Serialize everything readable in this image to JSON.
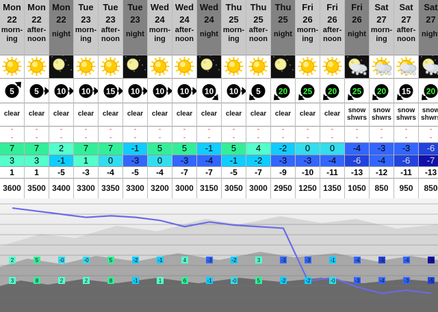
{
  "columns": [
    {
      "day": "Mon",
      "date": "22",
      "period": [
        "morn-",
        "ing"
      ],
      "night": false,
      "sym": "sun",
      "wind": "5",
      "windDir": "sw",
      "weather": [
        "clear"
      ],
      "rain": "-",
      "snow": "-",
      "max": "7",
      "min": "3",
      "chill": "1",
      "freezing": "3600"
    },
    {
      "day": "Mon",
      "date": "22",
      "period": [
        "after-",
        "noon"
      ],
      "night": false,
      "sym": "sun",
      "wind": "5",
      "windDir": "w",
      "weather": [
        "clear"
      ],
      "rain": "-",
      "snow": "-",
      "max": "7",
      "min": "3",
      "chill": "1",
      "freezing": "3500"
    },
    {
      "day": "Mon",
      "date": "22",
      "period": [
        "night"
      ],
      "night": true,
      "sym": "moon",
      "wind": "10",
      "windDir": "w",
      "weather": [
        "clear"
      ],
      "rain": "-",
      "snow": "-",
      "max": "2",
      "min": "-1",
      "chill": "-5",
      "freezing": "3400"
    },
    {
      "day": "Tue",
      "date": "23",
      "period": [
        "morn-",
        "ing"
      ],
      "night": false,
      "sym": "sun",
      "wind": "10",
      "windDir": "w",
      "weather": [
        "clear"
      ],
      "rain": "-",
      "snow": "-",
      "max": "7",
      "min": "1",
      "chill": "-3",
      "freezing": "3300"
    },
    {
      "day": "Tue",
      "date": "23",
      "period": [
        "after-",
        "noon"
      ],
      "night": false,
      "sym": "sun",
      "wind": "15",
      "windDir": "w",
      "weather": [
        "clear"
      ],
      "rain": "-",
      "snow": "-",
      "max": "7",
      "min": "0",
      "chill": "-4",
      "freezing": "3350"
    },
    {
      "day": "Tue",
      "date": "23",
      "period": [
        "night"
      ],
      "night": true,
      "sym": "moon",
      "wind": "10",
      "windDir": "w",
      "weather": [
        "clear"
      ],
      "rain": "-",
      "snow": "-",
      "max": "-1",
      "min": "-3",
      "chill": "-5",
      "freezing": "3300"
    },
    {
      "day": "Wed",
      "date": "24",
      "period": [
        "morn-",
        "ing"
      ],
      "night": false,
      "sym": "sun",
      "wind": "10",
      "windDir": "w",
      "weather": [
        "clear"
      ],
      "rain": "-",
      "snow": "-",
      "max": "5",
      "min": "0",
      "chill": "-4",
      "freezing": "3200"
    },
    {
      "day": "Wed",
      "date": "24",
      "period": [
        "after-",
        "noon"
      ],
      "night": false,
      "sym": "sun",
      "wind": "10",
      "windDir": "w",
      "weather": [
        "clear"
      ],
      "rain": "-",
      "snow": "-",
      "max": "5",
      "min": "-3",
      "chill": "-7",
      "freezing": "3000"
    },
    {
      "day": "Wed",
      "date": "24",
      "period": [
        "night"
      ],
      "night": true,
      "sym": "moon",
      "wind": "10",
      "windDir": "nw",
      "weather": [
        "clear"
      ],
      "rain": "-",
      "snow": "-",
      "max": "-1",
      "min": "-4",
      "chill": "-7",
      "freezing": "3150"
    },
    {
      "day": "Thu",
      "date": "25",
      "period": [
        "morn-",
        "ing"
      ],
      "night": false,
      "sym": "sun",
      "wind": "10",
      "windDir": "w",
      "weather": [
        "clear"
      ],
      "rain": "-",
      "snow": "-",
      "max": "5",
      "min": "-1",
      "chill": "-5",
      "freezing": "3050"
    },
    {
      "day": "Thu",
      "date": "25",
      "period": [
        "after-",
        "noon"
      ],
      "night": false,
      "sym": "sun",
      "wind": "5",
      "windDir": "ne",
      "weather": [
        "clear"
      ],
      "rain": "-",
      "snow": "-",
      "max": "4",
      "min": "-2",
      "chill": "-7",
      "freezing": "3000"
    },
    {
      "day": "Thu",
      "date": "25",
      "period": [
        "night"
      ],
      "night": true,
      "sym": "moon",
      "wind": "20",
      "windDir": "ne",
      "weather": [
        "clear"
      ],
      "rain": "-",
      "snow": "-",
      "max": "-2",
      "min": "-3",
      "chill": "-9",
      "freezing": "2950"
    },
    {
      "day": "Fri",
      "date": "26",
      "period": [
        "morn-",
        "ing"
      ],
      "night": false,
      "sym": "sun",
      "wind": "25",
      "windDir": "ne",
      "weather": [
        "clear"
      ],
      "rain": "-",
      "snow": "-",
      "max": "0",
      "min": "-3",
      "chill": "-10",
      "freezing": "1250"
    },
    {
      "day": "Fri",
      "date": "26",
      "period": [
        "after-",
        "noon"
      ],
      "night": false,
      "sym": "sun",
      "wind": "20",
      "windDir": "ne",
      "weather": [
        "clear"
      ],
      "rain": "-",
      "snow": "-",
      "max": "0",
      "min": "-4",
      "chill": "-11",
      "freezing": "1350"
    },
    {
      "day": "Fri",
      "date": "26",
      "period": [
        "night"
      ],
      "night": true,
      "sym": "moonsnow",
      "wind": "25",
      "windDir": "ne",
      "weather": [
        "snow",
        "shwrs"
      ],
      "rain": "-",
      "snow": "-",
      "max": "-4",
      "min": "-6",
      "chill": "-13",
      "freezing": "1050"
    },
    {
      "day": "Sat",
      "date": "27",
      "period": [
        "morn-",
        "ing"
      ],
      "night": false,
      "sym": "sunsnow",
      "wind": "20",
      "windDir": "ne",
      "weather": [
        "snow",
        "shwrs"
      ],
      "rain": "-",
      "snow": "-",
      "max": "-3",
      "min": "-4",
      "chill": "-12",
      "freezing": "850"
    },
    {
      "day": "Sat",
      "date": "27",
      "period": [
        "after-",
        "noon"
      ],
      "night": false,
      "sym": "sunsnow",
      "wind": "15",
      "windDir": "ne",
      "weather": [
        "snow",
        "shwrs"
      ],
      "rain": "-",
      "snow": "-",
      "max": "-3",
      "min": "-6",
      "chill": "-11",
      "freezing": "950"
    },
    {
      "day": "Sat",
      "date": "27",
      "period": [
        "night"
      ],
      "night": true,
      "sym": "moonsnow",
      "wind": "20",
      "windDir": "ne",
      "weather": [
        "snow",
        "shwrs"
      ],
      "rain": "-",
      "snow": "-",
      "max": "-6",
      "min": "-7",
      "chill": "-13",
      "freezing": "850"
    }
  ],
  "chart_labels": {
    "row1": [
      "2",
      "5",
      "-0",
      "-0",
      "5",
      "-2",
      "-1",
      "4",
      "-3",
      "-2",
      "3",
      "-3",
      "-3",
      "-1",
      "-4",
      "-5",
      "-4",
      "-8"
    ],
    "row2": [
      "3",
      "8",
      "2",
      "2",
      "8",
      "-1",
      "1",
      "6",
      "-1",
      "-0",
      "5",
      "-2",
      "-2",
      "-0",
      "-3",
      "-4",
      "-3",
      "-5"
    ]
  },
  "colors": {
    "temp_warm": "#33ee99",
    "temp_mild": "#55ffcc",
    "temp_cool": "#33ddee",
    "temp_zero": "#11ccff",
    "temp_cold": "#3366ff",
    "temp_colder": "#2244dd",
    "temp_coldest": "#1111aa",
    "header_day": "#c9c9c9",
    "header_night": "#828282",
    "freezing_line": "#6a6ae8"
  }
}
